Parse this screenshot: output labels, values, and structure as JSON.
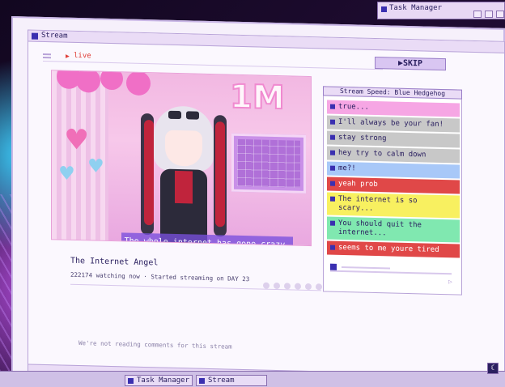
{
  "task_manager_window": {
    "title": "Task Manager"
  },
  "stream_window": {
    "title": "Stream",
    "live_label": "live",
    "skip_label": "▶SKIP"
  },
  "video": {
    "overlay_text": "1M",
    "subtitle": "The whole internet has gone crazy. Yo"
  },
  "stream_info": {
    "name": "The Internet Angel",
    "meta": "222174 watching now · Started streaming on DAY 23"
  },
  "comments_note": "We're not reading comments for this stream",
  "chat": {
    "speed_label": "Stream Speed: Blue Hedgehog",
    "messages": [
      {
        "text": "true...",
        "color": "#f6a6e4"
      },
      {
        "text": "I'll always be your fan!",
        "color": "#c8c8c8"
      },
      {
        "text": "stay strong",
        "color": "#c8c8c8"
      },
      {
        "text": "hey try to calm down",
        "color": "#c8c8c8"
      },
      {
        "text": "me?!",
        "color": "#a8c8f8"
      },
      {
        "text": "yeah prob",
        "color": "#e04848"
      },
      {
        "text": "The internet is so scary...",
        "color": "#f8f060"
      },
      {
        "text": "You should quit the internet...",
        "color": "#80e8b0"
      },
      {
        "text": "seems to me youre tired",
        "color": "#e04848"
      }
    ]
  },
  "taskbar": {
    "items": [
      {
        "label": "Task Manager"
      },
      {
        "label": "Stream"
      }
    ]
  }
}
